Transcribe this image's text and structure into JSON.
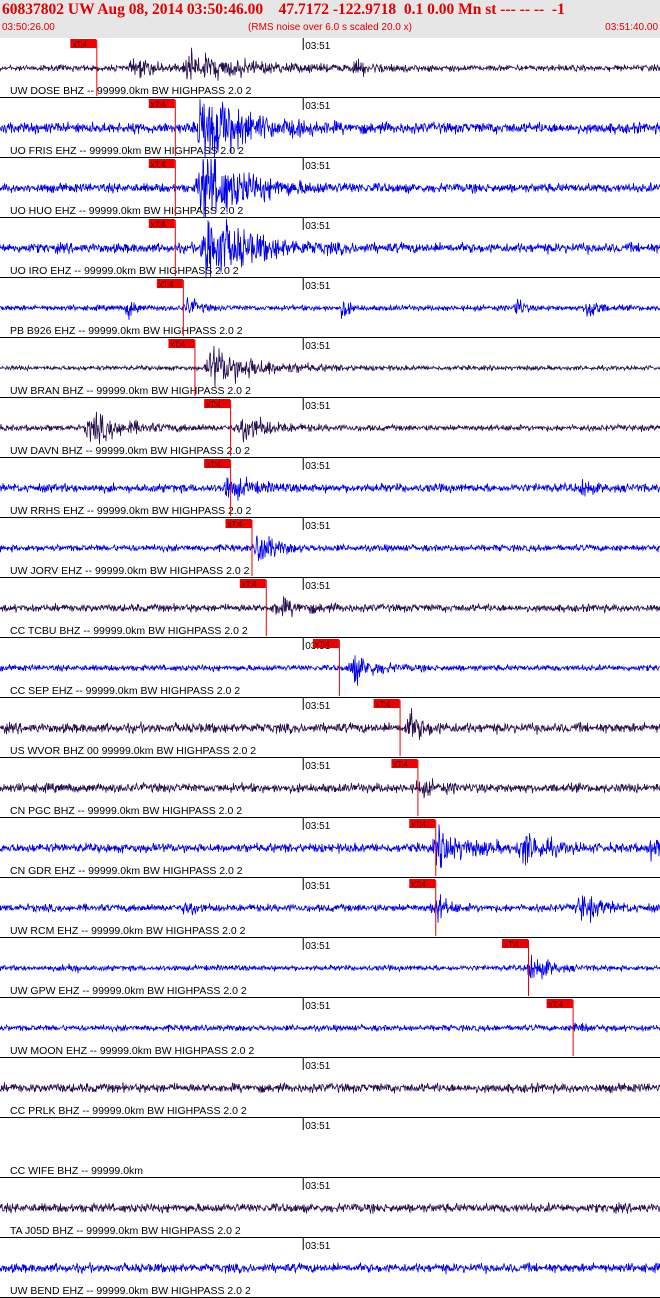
{
  "header": {
    "title": "60837802 UW Aug 08, 2014 03:50:46.00    47.7172 -122.9718  0.1 0.00 Mn st --- -- --  -1",
    "start_time": "03:50:26.00",
    "scale_note": "(RMS noise over 6.0 s scaled 20.0 x)",
    "end_time": "03:51:40.00",
    "minute_tick_label": "03:51"
  },
  "colors": {
    "header_text": "#e00000",
    "header_bg": "#e6e6e6",
    "trace_blue": "#0000ee",
    "trace_purple": "#2a1050",
    "pick": "#ee0000",
    "grid": "#000000"
  },
  "chart_data": {
    "type": "seismogram",
    "time_start": "03:50:26.00",
    "time_end": "03:51:40.00",
    "time_start_s": 0,
    "time_end_s": 74,
    "minute_tick_s": 34,
    "pick_label": "xT:4",
    "traces": [
      {
        "label": "UW DOSE BHZ -- 99999.0km BW  HIGHPASS  2.0  2",
        "color": "purple",
        "pick_s": 10.8,
        "events": [
          {
            "t": 21,
            "w": 12,
            "a": 0.9
          },
          {
            "t": 15,
            "w": 5,
            "a": 0.55
          },
          {
            "t": 40,
            "w": 5,
            "a": 0.3
          }
        ],
        "noise": 0.2
      },
      {
        "label": "UO FRIS EHZ -- 99999.0km BW  HIGHPASS  2.0  2",
        "color": "blue",
        "pick_s": 19.6,
        "events": [
          {
            "t": 22.5,
            "w": 8,
            "a": 2.6
          }
        ],
        "noise": 0.35
      },
      {
        "label": "UO HUO EHZ -- 99999.0km BW  HIGHPASS  2.0  2",
        "color": "blue",
        "pick_s": 19.6,
        "events": [
          {
            "t": 22.5,
            "w": 8,
            "a": 2.6
          }
        ],
        "noise": 0.3
      },
      {
        "label": "UO IRO EHZ -- 99999.0km BW  HIGHPASS  2.0  2",
        "color": "blue",
        "pick_s": 19.6,
        "events": [
          {
            "t": 23,
            "w": 8,
            "a": 2.6
          }
        ],
        "noise": 0.32
      },
      {
        "label": "PB B926 EHZ -- 99999.0km BW  HIGHPASS  2.0  2",
        "color": "blue",
        "pick_s": 20.5,
        "events": [
          {
            "t": 21,
            "w": 2,
            "a": 0.7
          },
          {
            "t": 14.5,
            "w": 1,
            "a": 0.9
          },
          {
            "t": 38.5,
            "w": 1,
            "a": 0.8
          },
          {
            "t": 58,
            "w": 1,
            "a": 0.9
          },
          {
            "t": 66,
            "w": 1.5,
            "a": 1.1
          }
        ],
        "noise": 0.18
      },
      {
        "label": "UW BRAN BHZ -- 99999.0km BW  HIGHPASS  2.0  2",
        "color": "purple",
        "pick_s": 21.8,
        "events": [
          {
            "t": 23.5,
            "w": 9,
            "a": 1.4
          }
        ],
        "noise": 0.15
      },
      {
        "label": "UW DAVN BHZ -- 99999.0km BW  HIGHPASS  2.0  2",
        "color": "purple",
        "pick_s": 25.8,
        "events": [
          {
            "t": 10,
            "w": 7,
            "a": 1.0
          },
          {
            "t": 27,
            "w": 5,
            "a": 1.0
          }
        ],
        "noise": 0.2
      },
      {
        "label": "UW RRHS EHZ -- 99999.0km BW  HIGHPASS  2.0  2",
        "color": "blue",
        "pick_s": 25.8,
        "events": [
          {
            "t": 25.5,
            "w": 4,
            "a": 0.8
          },
          {
            "t": 65.5,
            "w": 1,
            "a": 0.9
          }
        ],
        "noise": 0.28
      },
      {
        "label": "UW JORV EHZ -- 99999.0km BW  HIGHPASS  2.0  2",
        "color": "blue",
        "pick_s": 28.2,
        "events": [
          {
            "t": 29,
            "w": 3,
            "a": 1.2
          }
        ],
        "noise": 0.22
      },
      {
        "label": "CC TCBU BHZ -- 99999.0km BW  HIGHPASS  2.0  2",
        "color": "purple",
        "pick_s": 29.8,
        "events": [
          {
            "t": 31,
            "w": 5,
            "a": 0.55
          }
        ],
        "noise": 0.25
      },
      {
        "label": "CC SEP EHZ -- 99999.0km BW  HIGHPASS  2.0  2",
        "color": "blue",
        "pick_s": 38.0,
        "events": [
          {
            "t": 39.5,
            "w": 4,
            "a": 1.0
          }
        ],
        "noise": 0.2
      },
      {
        "label": "US WVOR BHZ 00 99999.0km BW  HIGHPASS  2.0  2",
        "color": "purple",
        "pick_s": 44.8,
        "events": [
          {
            "t": 45.7,
            "w": 3,
            "a": 1.0
          }
        ],
        "noise": 0.32
      },
      {
        "label": "CN PGC BHZ -- 99999.0km BW  HIGHPASS  2.0  2",
        "color": "purple",
        "pick_s": 46.8,
        "events": [
          {
            "t": 47,
            "w": 4,
            "a": 0.4
          }
        ],
        "noise": 0.3
      },
      {
        "label": "CN GDR EHZ -- 99999.0km BW  HIGHPASS  2.0  2",
        "color": "blue",
        "pick_s": 48.8,
        "events": [
          {
            "t": 49,
            "w": 6,
            "a": 1.1
          },
          {
            "t": 58.5,
            "w": 4,
            "a": 1.1
          },
          {
            "t": 73,
            "w": 1.5,
            "a": 0.8
          }
        ],
        "noise": 0.3
      },
      {
        "label": "UW RCM EHZ -- 99999.0km BW  HIGHPASS  2.0  2",
        "color": "blue",
        "pick_s": 48.8,
        "events": [
          {
            "t": 48.8,
            "w": 2,
            "a": 1.0
          },
          {
            "t": 21,
            "w": 1.5,
            "a": 0.6
          },
          {
            "t": 65,
            "w": 4,
            "a": 0.9
          }
        ],
        "noise": 0.25
      },
      {
        "label": "UW GPW EHZ -- 99999.0km BW  HIGHPASS  2.0  2",
        "color": "blue",
        "pick_s": 59.2,
        "events": [
          {
            "t": 59.5,
            "w": 3,
            "a": 1.1
          },
          {
            "t": 7.8,
            "w": 1,
            "a": 0.55
          }
        ],
        "noise": 0.18
      },
      {
        "label": "UW MOON EHZ -- 99999.0km BW  HIGHPASS  2.0  2",
        "color": "blue",
        "pick_s": 64.2,
        "events": [
          {
            "t": 64.5,
            "w": 2,
            "a": 0.45
          }
        ],
        "noise": 0.2
      },
      {
        "label": "CC PRLK BHZ -- 99999.0km BW  HIGHPASS  2.0  2",
        "color": "purple",
        "pick_s": null,
        "events": [],
        "noise": 0.3
      },
      {
        "label": "CC WIFE BHZ -- 99999.0km",
        "color": "none",
        "pick_s": null,
        "events": [],
        "noise": 0
      },
      {
        "label": "TA J05D BHZ -- 99999.0km BW  HIGHPASS  2.0  2",
        "color": "purple",
        "pick_s": null,
        "events": [],
        "noise": 0.3
      },
      {
        "label": "UW BEND EHZ -- 99999.0km BW  HIGHPASS  2.0  2",
        "color": "blue",
        "pick_s": null,
        "events": [],
        "noise": 0.3
      }
    ]
  }
}
